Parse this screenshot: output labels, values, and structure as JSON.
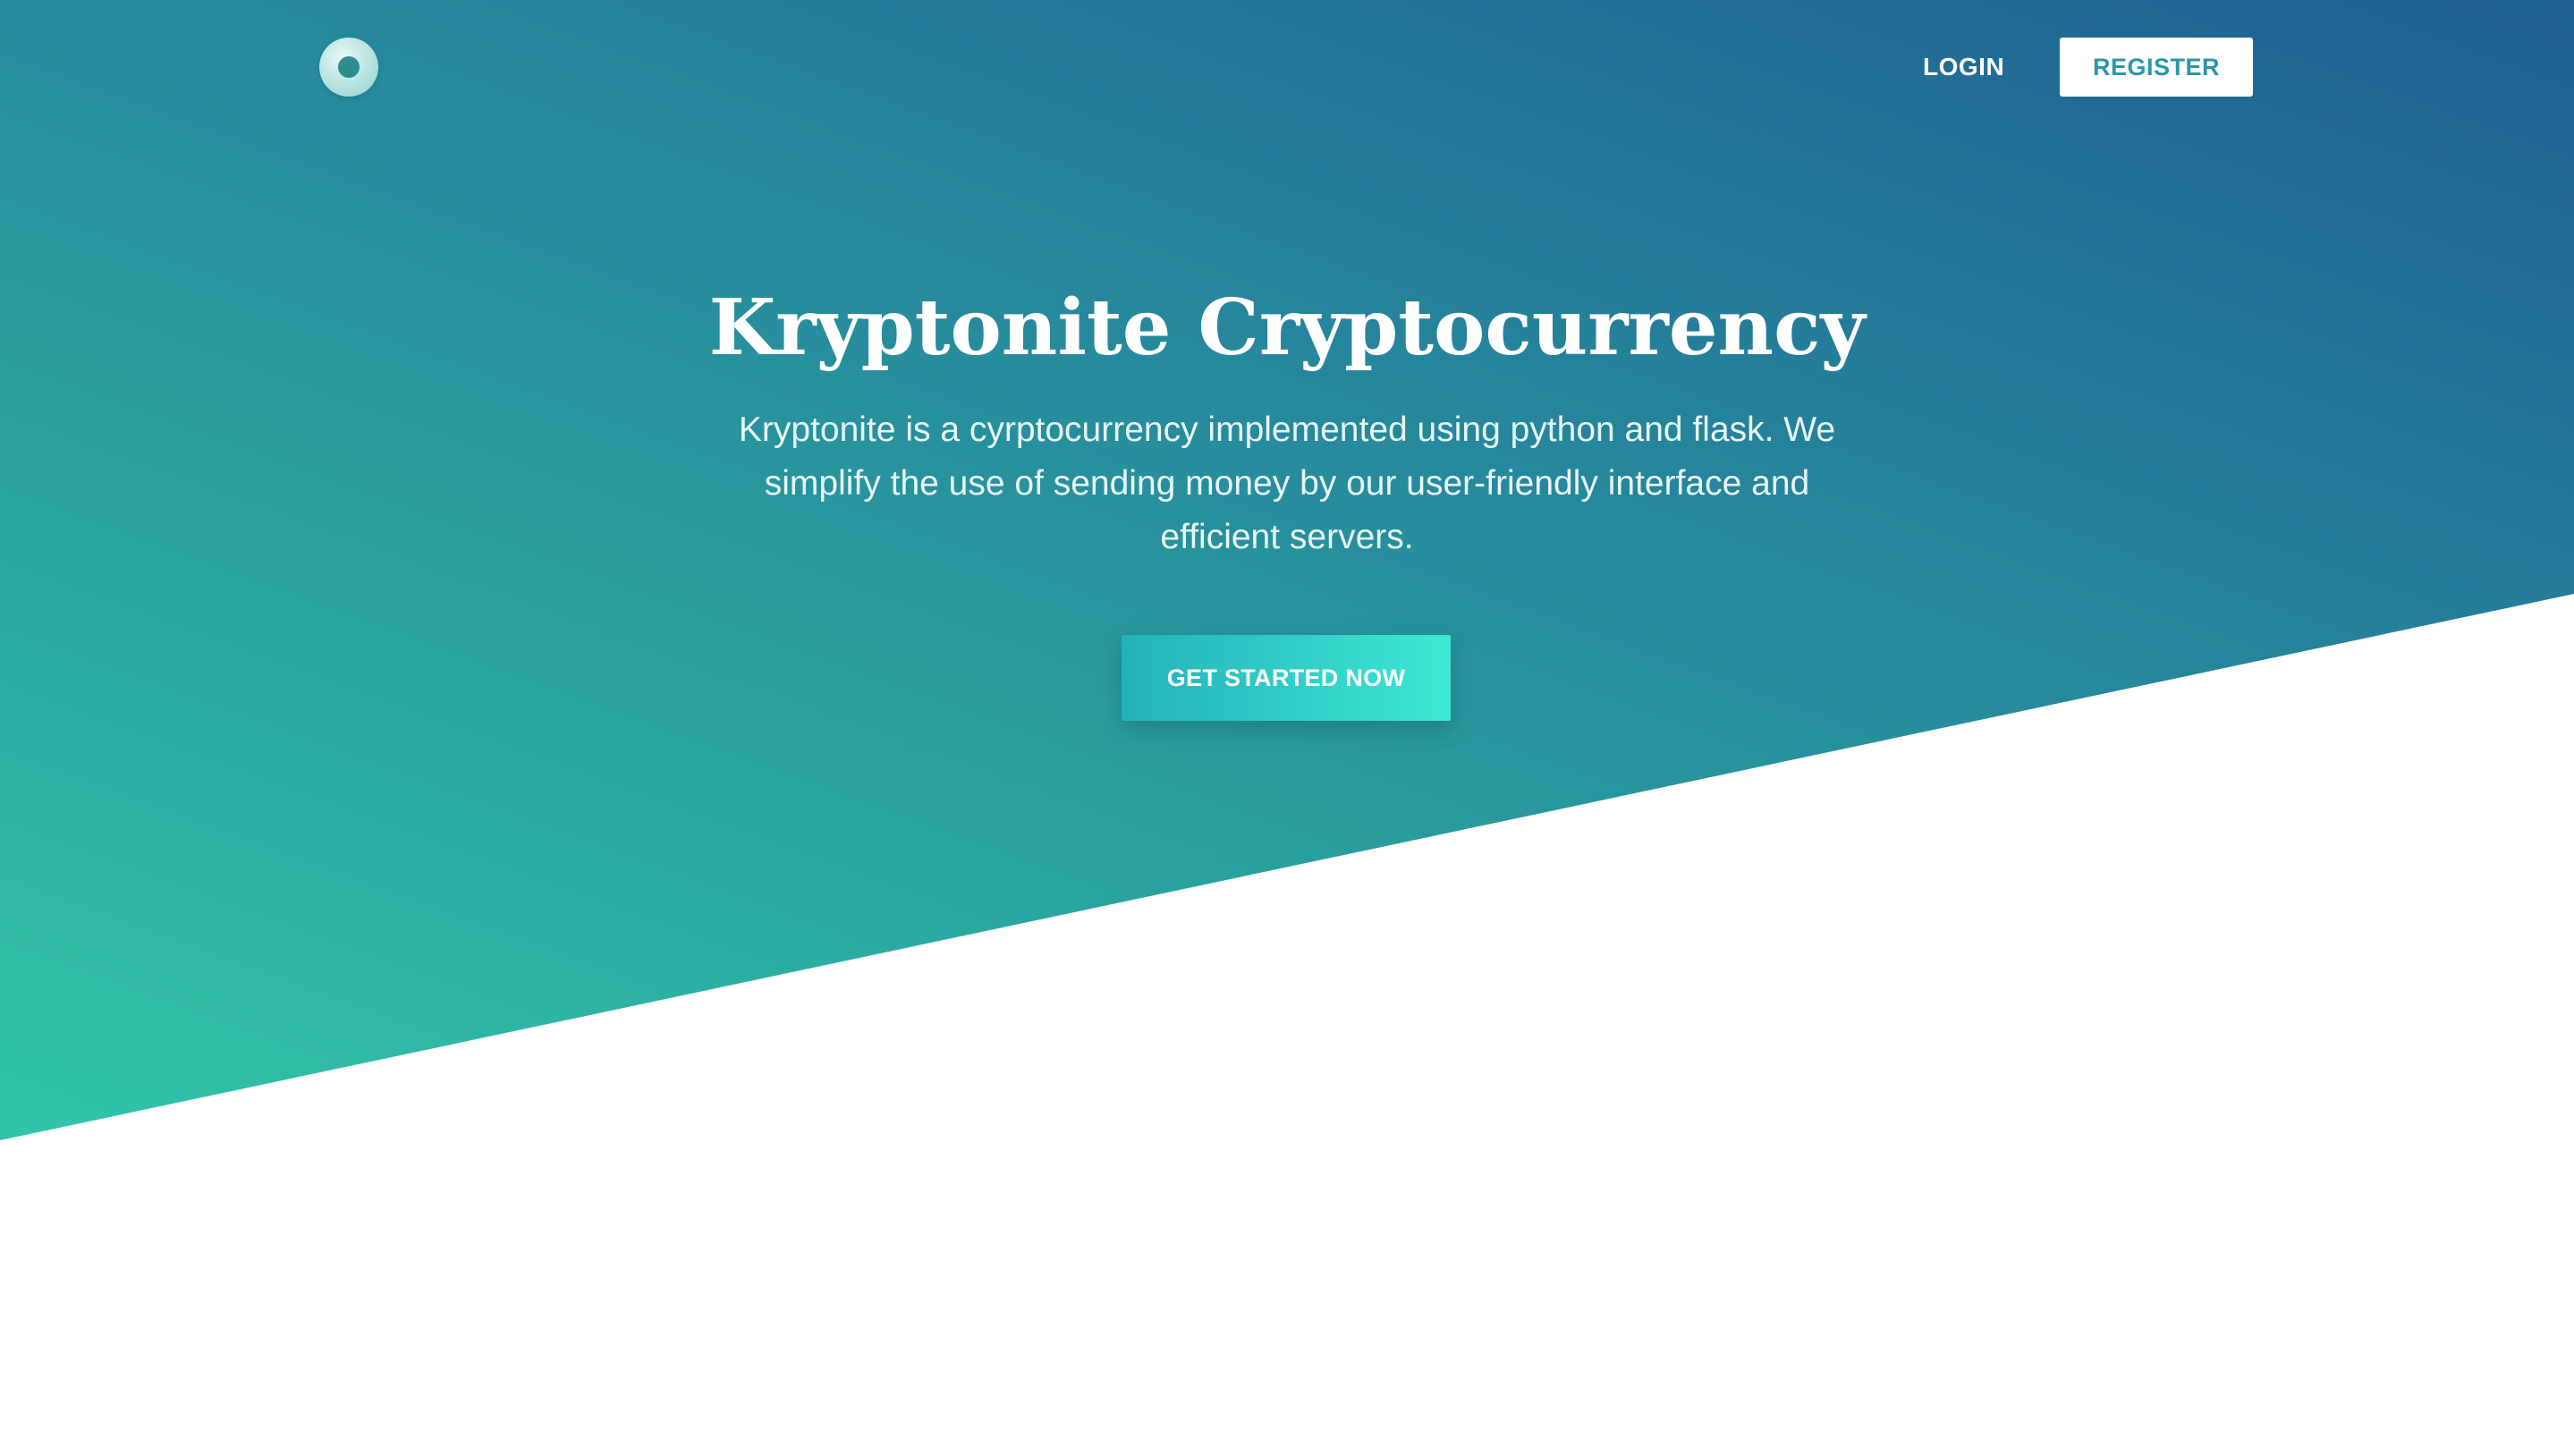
{
  "nav": {
    "logo_name": "logo-icon",
    "login_label": "LOGIN",
    "register_label": "REGISTER"
  },
  "hero": {
    "title": "Kryptonite Cryptocurrency",
    "description": "Kryptonite is a cyrptocurrency implemented using python and flask. We simplify the use of sending money by our user-friendly interface and efficient servers.",
    "cta_label": "GET STARTED NOW"
  },
  "colors": {
    "gradient_start": "#32c5aa",
    "gradient_end": "#1f5f92",
    "accent": "#2a97a6",
    "cta_start": "#24b1b9",
    "cta_end": "#3de8d5",
    "background": "#ffffff"
  }
}
